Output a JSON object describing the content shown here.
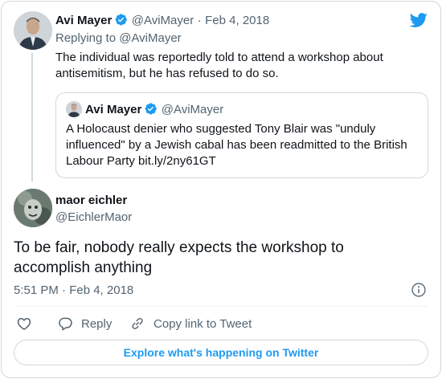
{
  "colors": {
    "brand_blue": "#1d9bf0",
    "text_primary": "#0f1419",
    "text_secondary": "#536471",
    "border": "#cfd9de"
  },
  "icons": {
    "logo": "twitter-bird-icon",
    "verified": "verified-badge-icon",
    "info": "info-icon",
    "like": "heart-icon",
    "reply": "speech-bubble-icon",
    "copy_link": "link-icon"
  },
  "parent_tweet": {
    "author_name": "Avi Mayer",
    "author_handle": "@AviMayer",
    "separator": "·",
    "date": "Feb 4, 2018",
    "replying_to": "Replying to @AviMayer",
    "text": "The individual was reportedly told to attend a workshop about antisemitism, but he has refused to do so."
  },
  "quoted_tweet": {
    "author_name": "Avi Mayer",
    "author_handle": "@AviMayer",
    "text": "A Holocaust denier who suggested Tony Blair was \"unduly influenced\" by a Jewish cabal has been readmitted to the British Labour Party bit.ly/2ny61GT"
  },
  "main_tweet": {
    "author_name": "maor eichler",
    "author_handle": "@EichlerMaor",
    "text": "To be fair, nobody really expects the workshop to accomplish anything",
    "timestamp": "5:51 PM · Feb 4, 2018"
  },
  "actions": {
    "reply_label": "Reply",
    "copy_link_label": "Copy link to Tweet"
  },
  "explore_label": "Explore what's happening on Twitter"
}
